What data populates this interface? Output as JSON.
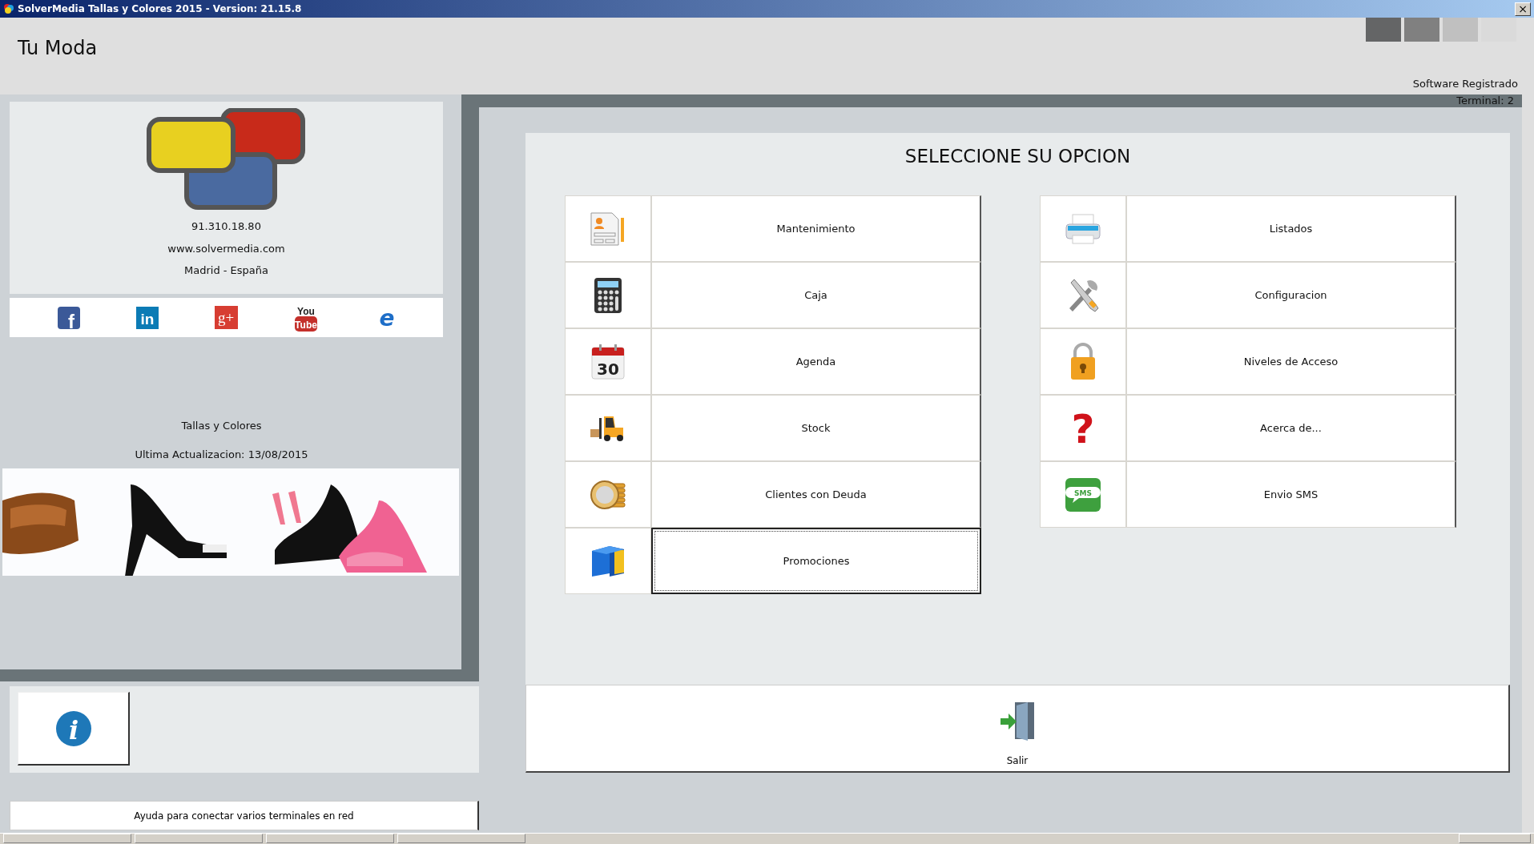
{
  "window": {
    "title": "SolverMedia Tallas y Colores 2015  -  Version: 21.15.8",
    "close": "×"
  },
  "header": {
    "shop_name": "Tu Moda",
    "registration": "Software Registrado",
    "theme_swatches": [
      {
        "color": "#646566"
      },
      {
        "color": "#808080"
      },
      {
        "color": "#c0c0c0"
      },
      {
        "color": "#dadada"
      }
    ]
  },
  "terminal": "Terminal: 2",
  "company": {
    "phone": "91.310.18.80",
    "website": "www.solvermedia.com",
    "location": "Madrid - España"
  },
  "social": [
    {
      "kind": "facebook",
      "glyph": "f"
    },
    {
      "kind": "linkedin",
      "glyph": "in"
    },
    {
      "kind": "google",
      "glyph": "g+"
    },
    {
      "kind": "youtube",
      "glyph": "You",
      "glyph2": "Tube"
    },
    {
      "kind": "browser",
      "glyph": "e"
    }
  ],
  "product": {
    "name": "Tallas y Colores",
    "updated": "Ultima Actualizacion: 13/08/2015"
  },
  "help_button": "Ayuda para conectar varios terminales en red",
  "menu": {
    "title": "SELECCIONE SU OPCION",
    "columns": [
      [
        {
          "label": "Mantenimiento",
          "kind": "document",
          "focused": false
        },
        {
          "label": "Caja",
          "kind": "calculator",
          "focused": false
        },
        {
          "label": "Agenda",
          "kind": "calendar",
          "icon_text": "30",
          "focused": false
        },
        {
          "label": "Stock",
          "kind": "forklift",
          "focused": false
        },
        {
          "label": "Clientes con Deuda",
          "kind": "coins",
          "focused": false
        },
        {
          "label": "Promociones",
          "kind": "cube",
          "focused": true
        }
      ],
      [
        {
          "label": "Listados",
          "kind": "printer",
          "focused": false
        },
        {
          "label": "Configuracion",
          "kind": "tools",
          "focused": false
        },
        {
          "label": "Niveles de Acceso",
          "kind": "padlock",
          "focused": false
        },
        {
          "label": "Acerca de...",
          "kind": "question",
          "icon_text": "?",
          "focused": false
        },
        {
          "label": "Envio SMS",
          "kind": "sms",
          "icon_text": "SMS",
          "focused": false
        }
      ]
    ]
  },
  "exit_button": {
    "label": "Salir"
  },
  "info_button": {
    "glyph": "i"
  }
}
